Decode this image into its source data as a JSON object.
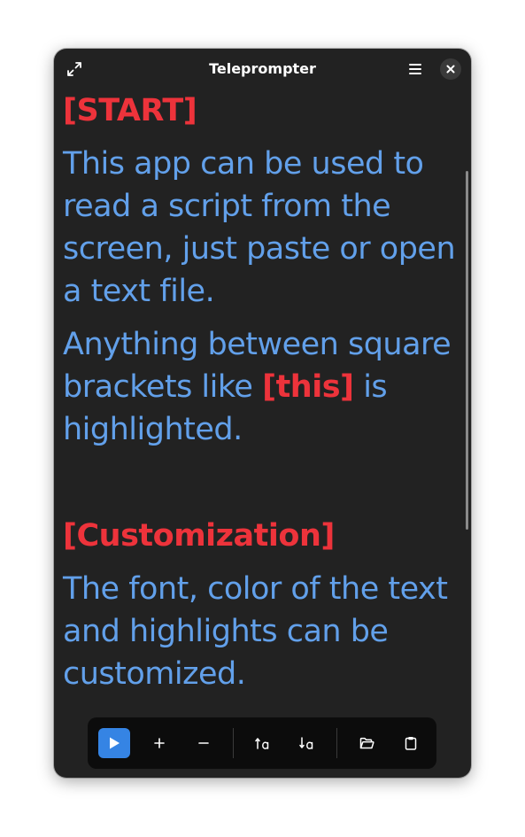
{
  "window": {
    "title": "Teleprompter"
  },
  "header": {
    "icons": [
      "fullscreen-icon",
      "hamburger-menu-icon",
      "close-icon"
    ]
  },
  "script": {
    "start_tag": "[START]",
    "para1": "This app can be used to read a script from the screen, just paste or open a text file.",
    "para2_prefix": "Anything between square brackets like ",
    "para2_highlight": "[this]",
    "para2_suffix": " is highlighted.",
    "customization_tag": "[Customization]",
    "para3": "The font, color of the text and highlights can be customized."
  },
  "colors": {
    "text": "#62a0ea",
    "highlight": "#ed333b",
    "background": "#222222",
    "accent": "#3584e4"
  },
  "toolbar": {
    "buttons": [
      {
        "name": "play-button",
        "icon": "play-icon"
      },
      {
        "name": "increase-speed-button",
        "icon": "plus-icon"
      },
      {
        "name": "decrease-speed-button",
        "icon": "minus-icon"
      },
      {
        "name": "increase-font-button",
        "icon": "font-size-up-icon"
      },
      {
        "name": "decrease-font-button",
        "icon": "font-size-down-icon"
      },
      {
        "name": "open-file-button",
        "icon": "folder-open-icon"
      },
      {
        "name": "paste-button",
        "icon": "clipboard-icon"
      }
    ]
  }
}
